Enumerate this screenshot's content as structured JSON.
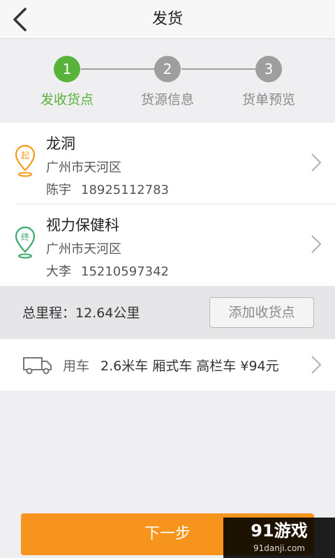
{
  "header": {
    "title": "发货"
  },
  "steps": [
    {
      "number": "1",
      "label": "发收货点",
      "active": true
    },
    {
      "number": "2",
      "label": "货源信息",
      "active": false
    },
    {
      "number": "3",
      "label": "货单预览",
      "active": false
    }
  ],
  "addresses": [
    {
      "badge": "起",
      "name": "龙洞",
      "city": "广州市天河区",
      "contact_name": "陈宇",
      "phone": "18925112783",
      "color": "#f39a1e"
    },
    {
      "badge": "终",
      "name": "视力保健科",
      "city": "广州市天河区",
      "contact_name": "大李",
      "phone": "15210597342",
      "color": "#3aa86a"
    }
  ],
  "distance": {
    "text": "总里程：12.64公里",
    "add_button": "添加收货点"
  },
  "vehicle": {
    "label": "用车",
    "detail": "2.6米车 厢式车 高栏车 ¥94元"
  },
  "next_button": "下一步",
  "watermark": {
    "main": "91游戏",
    "sub": "91danji.com"
  },
  "colors": {
    "accent_green": "#58b33a",
    "accent_orange": "#f7941d",
    "step_gray": "#9e9e9e"
  }
}
